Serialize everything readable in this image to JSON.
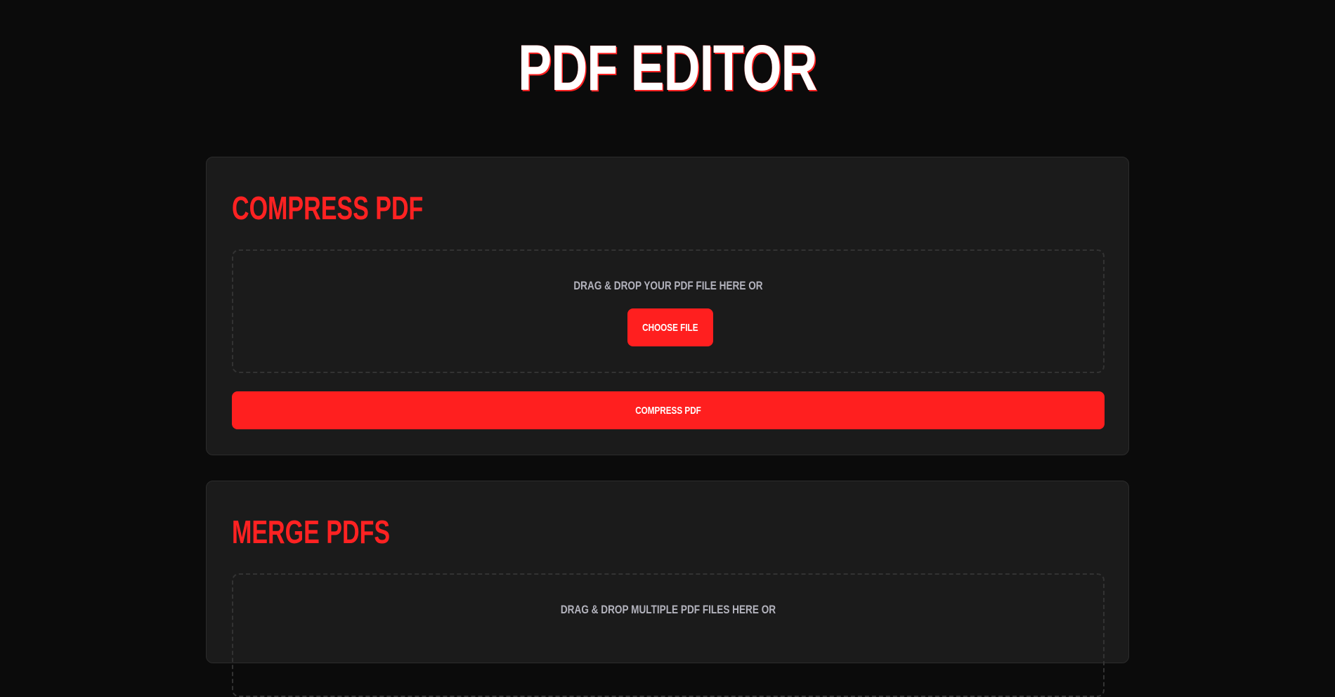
{
  "header": {
    "title": "PDF EDITOR"
  },
  "compress": {
    "title": "COMPRESS PDF",
    "drop_text": "DRAG & DROP YOUR PDF FILE HERE OR",
    "choose_label": "CHOOSE FILE",
    "action_label": "COMPRESS PDF"
  },
  "merge": {
    "title": "MERGE PDFS",
    "drop_text": "DRAG & DROP MULTIPLE PDF FILES HERE OR"
  },
  "colors": {
    "background": "#0b0b0b",
    "card": "#1b1b1b",
    "accent": "#ff1f1f",
    "muted_text": "#b3b3bd"
  }
}
